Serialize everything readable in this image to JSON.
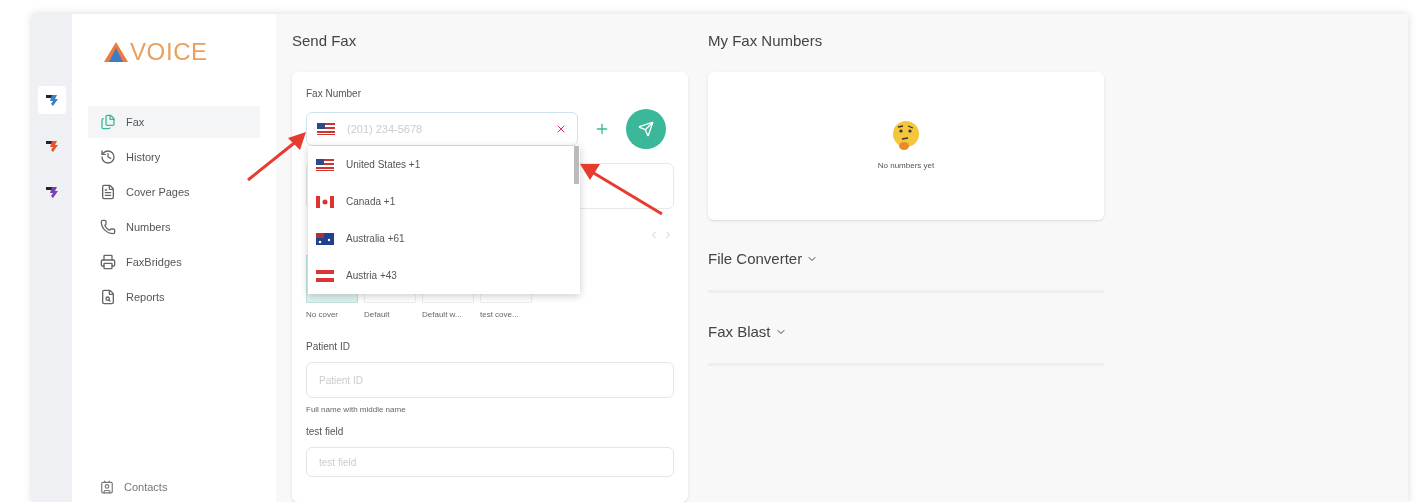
{
  "logo": {
    "text": "VOICE"
  },
  "apps": [
    {
      "selected": true,
      "color": "#3b82c4"
    },
    {
      "selected": false,
      "color": "#e8552b"
    },
    {
      "selected": false,
      "color": "#7a3fb0"
    }
  ],
  "nav": [
    {
      "label": "Fax",
      "selected": true
    },
    {
      "label": "History",
      "selected": false
    },
    {
      "label": "Cover Pages",
      "selected": false
    },
    {
      "label": "Numbers",
      "selected": false
    },
    {
      "label": "FaxBridges",
      "selected": false
    },
    {
      "label": "Reports",
      "selected": false
    }
  ],
  "nav_bottom": {
    "label": "Contacts"
  },
  "send_fax": {
    "title": "Send Fax",
    "fax_label": "Fax Number",
    "fax_placeholder": "(201) 234-5678",
    "countries": [
      {
        "label": "United States +1",
        "kind": "us"
      },
      {
        "label": "Canada +1",
        "kind": "ca"
      },
      {
        "label": "Australia +61",
        "kind": "au"
      },
      {
        "label": "Austria +43",
        "kind": "at"
      }
    ],
    "covers": [
      {
        "label": "No cover",
        "selected": true
      },
      {
        "label": "Default",
        "selected": false
      },
      {
        "label": "Default w...",
        "selected": false
      },
      {
        "label": "test cove...",
        "selected": false
      }
    ],
    "patient_label": "Patient ID",
    "patient_placeholder": "Patient ID",
    "patient_help": "Full name with middle name",
    "test_label": "test field",
    "test_placeholder": "test field"
  },
  "fax_numbers": {
    "title": "My Fax Numbers",
    "empty": "No numbers yet"
  },
  "sections": [
    {
      "title": "File Converter",
      "expanded": false
    },
    {
      "title": "Fax Blast",
      "expanded": false
    }
  ]
}
